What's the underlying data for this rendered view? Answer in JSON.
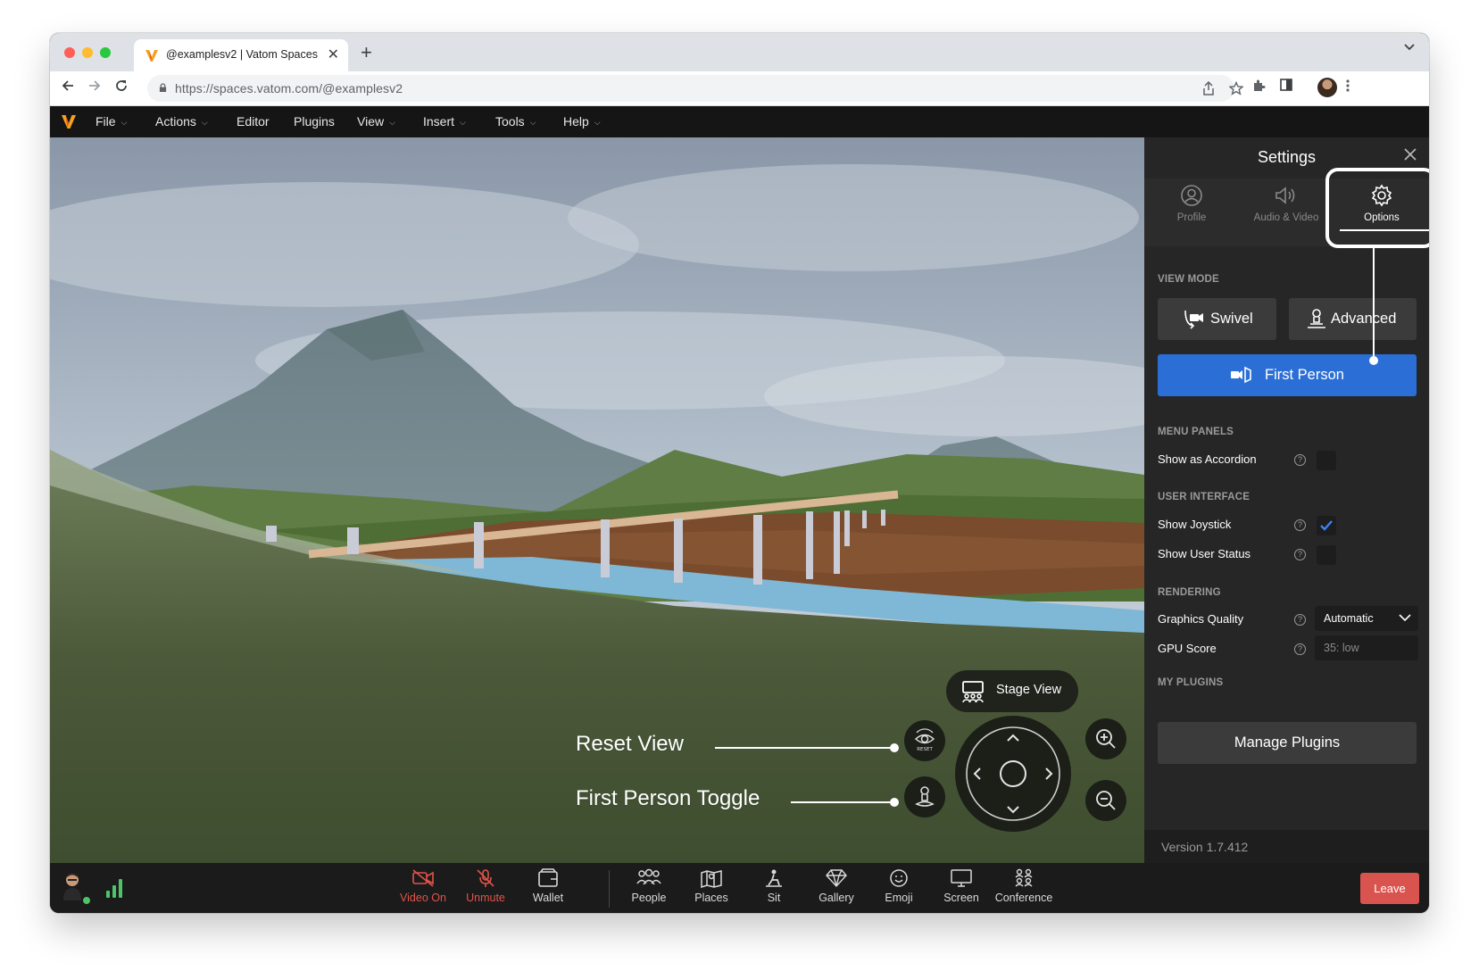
{
  "browser": {
    "tab_title": "@examplesv2 | Vatom Spaces",
    "url_host": "https://spaces.vatom.com",
    "url_path": "/@examplesv2",
    "tab_close": "✕",
    "new_tab": "+"
  },
  "app_menu": {
    "items": [
      "File",
      "Actions",
      "Editor",
      "Plugins",
      "View",
      "Insert",
      "Tools",
      "Help"
    ]
  },
  "scene": {
    "stage_view_label": "Stage View",
    "annotations": {
      "reset_view": "Reset View",
      "first_person_toggle": "First Person Toggle"
    },
    "reset_icon_text": "RESET"
  },
  "settings": {
    "title": "Settings",
    "tabs": [
      {
        "label": "Profile",
        "icon": "profile-icon"
      },
      {
        "label": "Audio & Video",
        "icon": "speaker-icon"
      },
      {
        "label": "Options",
        "icon": "gear-icon"
      }
    ],
    "active_tab": "Options",
    "view_mode": {
      "heading": "VIEW MODE",
      "swivel": "Swivel",
      "advanced": "Advanced",
      "first_person": "First Person",
      "selected": "First Person"
    },
    "menu_panels": {
      "heading": "MENU PANELS",
      "show_as_accordion": {
        "label": "Show as Accordion",
        "checked": false
      }
    },
    "user_interface": {
      "heading": "USER INTERFACE",
      "show_joystick": {
        "label": "Show Joystick",
        "checked": true
      },
      "show_user_status": {
        "label": "Show User Status",
        "checked": false
      }
    },
    "rendering": {
      "heading": "RENDERING",
      "graphics_quality_label": "Graphics Quality",
      "graphics_quality_value": "Automatic",
      "gpu_score_label": "GPU Score",
      "gpu_score_value": "35: low"
    },
    "my_plugins": {
      "heading": "MY PLUGINS",
      "manage_label": "Manage Plugins"
    },
    "version": "Version 1.7.412"
  },
  "bottom_bar": {
    "items": [
      {
        "label": "Video On",
        "icon": "video-off-icon"
      },
      {
        "label": "Unmute",
        "icon": "mic-off-icon"
      },
      {
        "label": "Wallet",
        "icon": "wallet-icon"
      },
      {
        "label": "People",
        "icon": "people-icon"
      },
      {
        "label": "Places",
        "icon": "places-icon"
      },
      {
        "label": "Sit",
        "icon": "sit-icon"
      },
      {
        "label": "Gallery",
        "icon": "gallery-icon"
      },
      {
        "label": "Emoji",
        "icon": "emoji-icon"
      },
      {
        "label": "Screen",
        "icon": "screen-icon"
      },
      {
        "label": "Conference",
        "icon": "conference-icon"
      }
    ],
    "leave_label": "Leave"
  },
  "colors": {
    "accent_blue": "#2b6fd6",
    "danger_red": "#d9534f",
    "muted_red": "#e0544a",
    "check_blue": "#3b82f6"
  }
}
